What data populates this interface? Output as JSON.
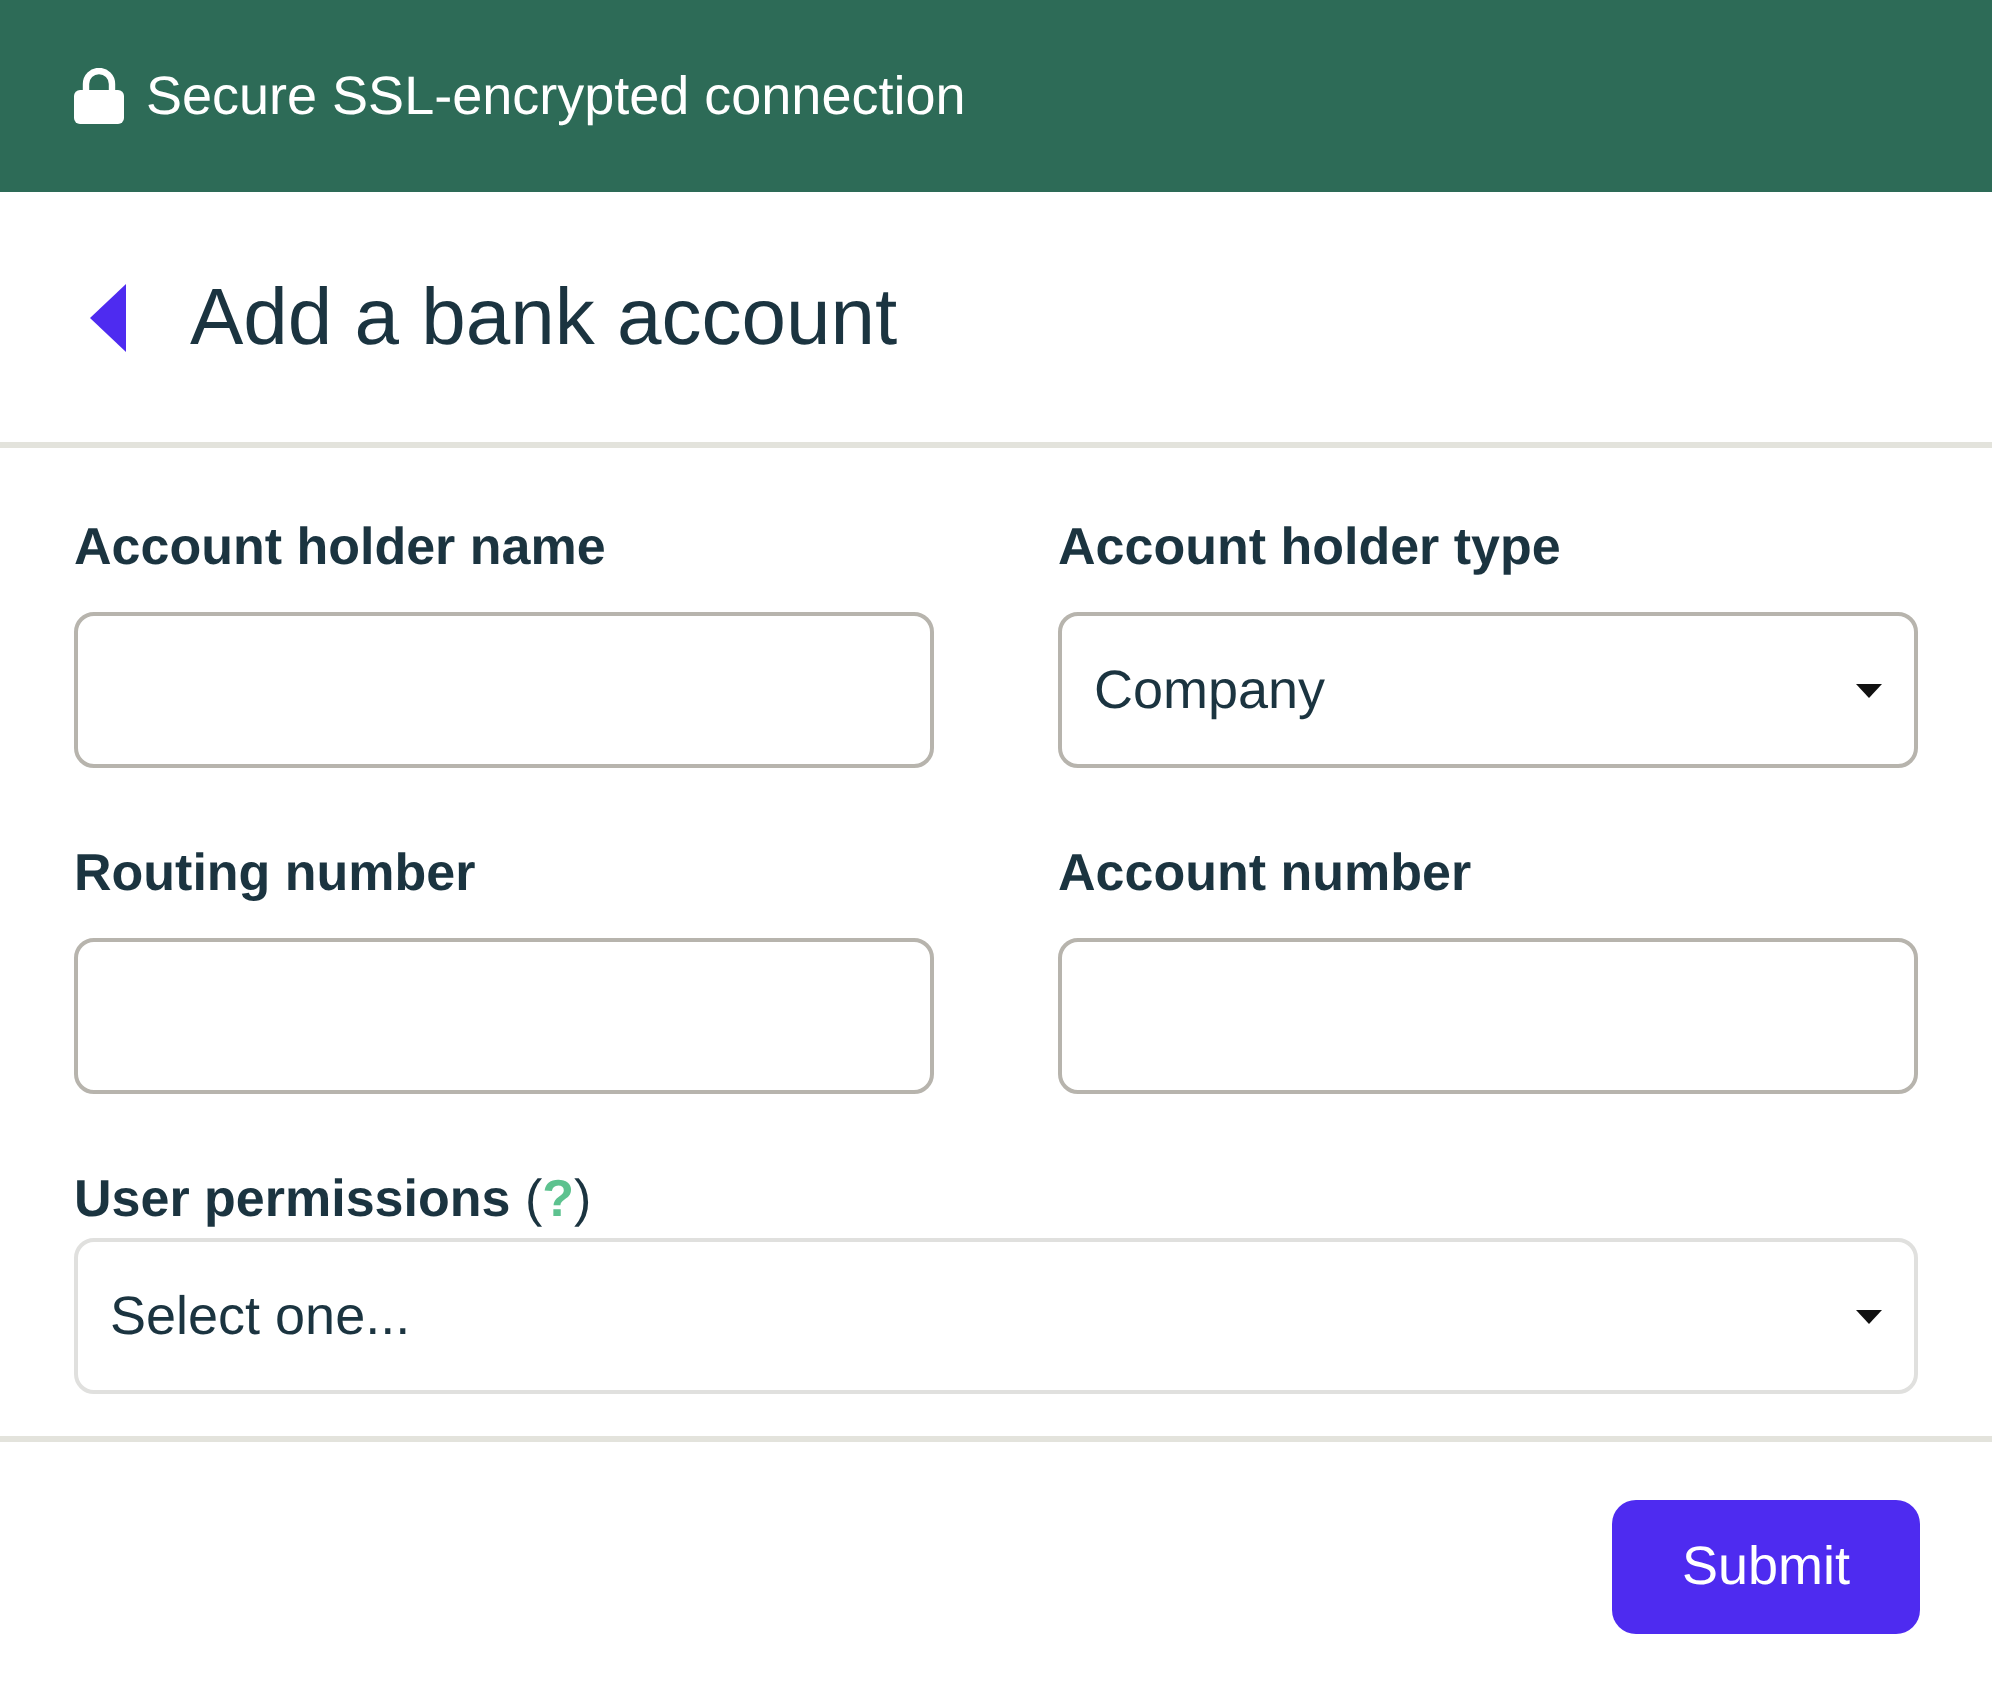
{
  "banner": {
    "text": "Secure SSL-encrypted connection"
  },
  "header": {
    "title": "Add a bank account"
  },
  "fields": [
    {
      "kind": "text",
      "label": "Account holder name"
    },
    {
      "kind": "select",
      "label": "Account holder type",
      "value": "Company"
    },
    {
      "kind": "text",
      "label": "Routing number"
    },
    {
      "kind": "text",
      "label": "Account number"
    }
  ],
  "permissions": {
    "kind": "select",
    "label": "User permissions",
    "help": {
      "before": "(",
      "link": "?",
      "after": ")"
    },
    "value": "Select one..."
  },
  "buttons": [
    {
      "label": "Submit"
    }
  ]
}
